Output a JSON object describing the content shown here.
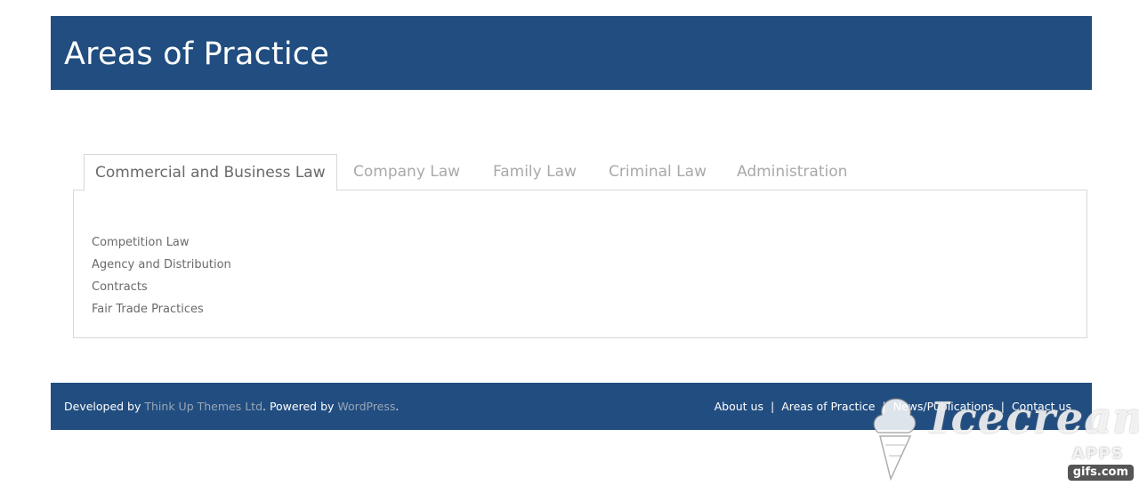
{
  "header": {
    "title": "Areas of Practice"
  },
  "tabs": [
    {
      "label": "Commercial and Business Law",
      "active": true
    },
    {
      "label": "Company Law",
      "active": false
    },
    {
      "label": "Family Law",
      "active": false
    },
    {
      "label": "Criminal Law",
      "active": false
    },
    {
      "label": "Administration",
      "active": false
    }
  ],
  "panel": {
    "items": [
      "Competition Law",
      "Agency and Distribution",
      "Contracts",
      "Fair Trade Practices"
    ]
  },
  "footer": {
    "developed_by": "Developed by ",
    "developer_link": "Think Up Themes Ltd",
    "powered_by": ". Powered by ",
    "powered_link": "WordPress",
    "end_period": ".",
    "nav": [
      "About us",
      "Areas of Practice",
      "News/Publications",
      "Contact us"
    ],
    "separator": "|"
  },
  "watermark": {
    "brand": "Icecream",
    "sub": "APPS",
    "badge": "gifs.com"
  },
  "colors": {
    "brand_blue": "#214d80",
    "tab_active_text": "#6a6a6a",
    "tab_inactive_text": "#a9a9a9",
    "link_muted": "#9aa6b6"
  }
}
